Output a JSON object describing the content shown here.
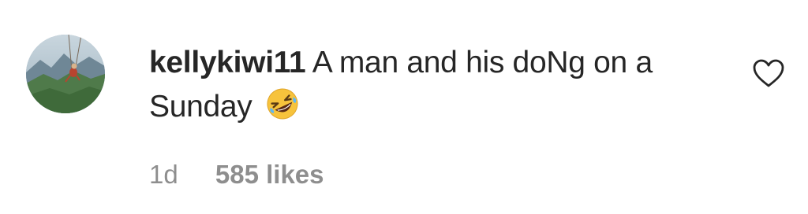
{
  "comment": {
    "username": "kellykiwi11",
    "text": "A man and his doNg on a Sunday",
    "emoji": "rolling-on-floor-laughing-emoji",
    "time": "1d",
    "likes": "585 likes"
  },
  "icons": {
    "like": "heart-outline-icon",
    "avatar": "profile-photo-mountain-swing"
  },
  "colors": {
    "text": "#262626",
    "meta": "#8e8e8e",
    "emoji_face": "#f7c33c"
  }
}
